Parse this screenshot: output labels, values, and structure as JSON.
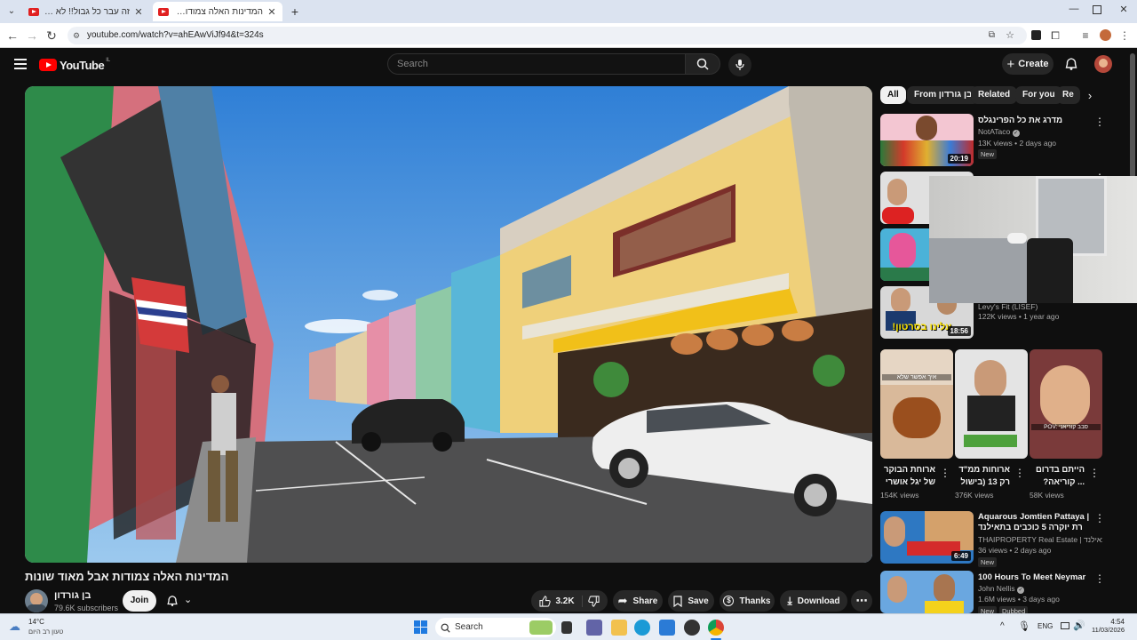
{
  "browser": {
    "tabs": [
      {
        "title": "זה עבר כל גבול!! לא תשחק",
        "active": false
      },
      {
        "title": "המדינות האלה צמודות אבל",
        "active": true
      }
    ],
    "new_tab": "+",
    "url": "youtube.com/watch?v=ahEAwViJf94&t=324s"
  },
  "header": {
    "logo": "YouTube",
    "country": "IL",
    "search_placeholder": "Search",
    "create_label": "Create"
  },
  "video": {
    "title": "המדינות האלה צמודות אבל מאוד שונות",
    "channel": "בן גורדון",
    "subscribers": "79.6K subscribers",
    "join_label": "Join",
    "likes": "3.2K",
    "share_label": "Share",
    "save_label": "Save",
    "thanks_label": "Thanks",
    "download_label": "Download"
  },
  "sidebar": {
    "chips": [
      "All",
      "From בן גורדון",
      "Related",
      "For you",
      "Re"
    ],
    "items": [
      {
        "title": "מדרג את כל הפרינגלס",
        "channel": "NotATaco",
        "meta": "13K views • 2 days ago",
        "badge": "New",
        "duration": "20:19"
      },
      {
        "title": "",
        "channel": "",
        "meta": "",
        "badge": "",
        "duration": ""
      },
      {
        "title": "",
        "channel": "",
        "meta": "",
        "badge": "",
        "duration": ""
      },
      {
        "title": "",
        "channel": "Levy's Fit (LISEF)",
        "meta": "122K views • 1 year ago",
        "badge": "",
        "duration": "18:56",
        "overlay_text": "עלינו בסרטון!"
      },
      {
        "title": "Aquarous Jomtien Pattaya | רת יוקרה 5 כוכבים בתאילנד במחיר...",
        "channel": "THAIPROPERTY Real Estate | נדל\"ן בתאילנד",
        "meta": "36 views • 2 days ago",
        "badge": "New",
        "duration": "6:49"
      },
      {
        "title": "100 Hours To Meet Neymar",
        "channel": "John Nellis",
        "meta": "1.6M views • 3 days ago",
        "badge": "New",
        "badge2": "Dubbed",
        "duration": ""
      }
    ],
    "shorts": [
      {
        "title": "ארוחת הבוקר של יגל אושרי",
        "views": "154K views",
        "caption": "איך אפשר שלא"
      },
      {
        "title": "ארוחות ממ\"ד רק 13 (בישול",
        "views": "376K views",
        "caption": ""
      },
      {
        "title": "הייתם בדרום ... קוריאה? אני",
        "views": "58K views",
        "caption": "POV: סבב קוריאני"
      }
    ]
  },
  "taskbar": {
    "weather_temp": "14°C",
    "weather_desc": "טעון רב היום",
    "search_label": "Search",
    "lang": "ENG",
    "time": "4:54",
    "date": "11/03/2026"
  },
  "colors": {
    "yt_red": "#ff0000",
    "background": "#0f0f0f",
    "chip_bg": "#272727"
  }
}
